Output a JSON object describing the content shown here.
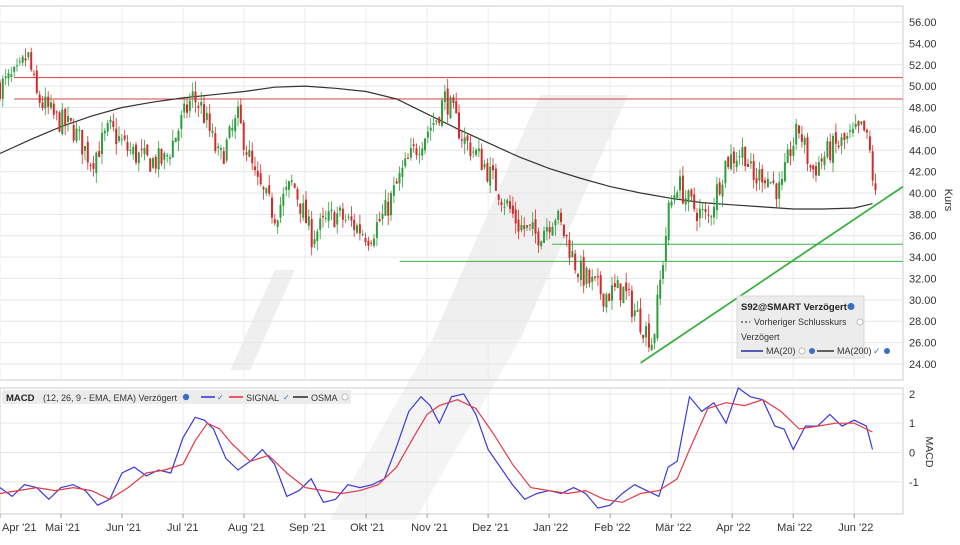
{
  "chart_data": [
    {
      "type": "candlestick",
      "title": "",
      "ylabel": "Kurs",
      "ylim": [
        22.5,
        57.5
      ],
      "y_ticks": [
        "24.00",
        "26.00",
        "28.00",
        "30.00",
        "32.00",
        "34.00",
        "36.00",
        "38.00",
        "40.00",
        "42.00",
        "44.00",
        "46.00",
        "48.00",
        "50.00",
        "52.00",
        "54.00",
        "56.00"
      ],
      "x_categories": [
        "Apr '21",
        "Mai '21",
        "Jun '21",
        "Jul '21",
        "Aug '21",
        "Sep '21",
        "Okt '21",
        "Nov '21",
        "Dez '21",
        "Jan '22",
        "Feb '22",
        "Mär '22",
        "Apr '22",
        "Mai '22",
        "Jun '22"
      ],
      "x_domain": [
        0,
        14.8
      ],
      "grid": true,
      "colors": {
        "up": "#2e9e3e",
        "down": "#d42a2a",
        "ma200": "#333333",
        "resistance": "#d94040",
        "support": "#3cb043"
      },
      "price_anchors": {
        "x": [
          0,
          0.3,
          0.45,
          0.6,
          0.9,
          1.2,
          1.5,
          1.8,
          2.1,
          2.4,
          2.7,
          3.0,
          3.15,
          3.3,
          3.6,
          3.9,
          4.2,
          4.5,
          4.8,
          5.1,
          5.3,
          5.5,
          5.8,
          6.05,
          6.3,
          6.6,
          6.9,
          7.15,
          7.3,
          7.45,
          7.6,
          7.9,
          8.2,
          8.5,
          8.8,
          9.1,
          9.3,
          9.45,
          9.6,
          9.9,
          10.2,
          10.5,
          10.7,
          10.85,
          10.95,
          11.1,
          11.3,
          11.6,
          11.9,
          12.2,
          12.35,
          12.5,
          12.8,
          12.95,
          13.1,
          13.3,
          13.6,
          13.9,
          14.15,
          14.25,
          14.35
        ],
        "y": [
          50,
          51,
          53,
          49,
          47,
          46,
          43,
          46,
          44,
          43,
          43,
          47,
          49,
          48,
          43,
          47,
          41,
          38,
          41,
          36,
          37,
          38,
          37,
          36,
          38,
          42,
          45,
          47,
          49,
          47,
          45,
          43,
          40,
          37,
          36,
          38,
          35.5,
          33,
          32,
          30.5,
          31,
          28,
          26,
          33,
          38,
          41,
          39,
          37.5,
          43,
          44,
          41,
          42,
          40,
          44,
          46,
          42,
          44,
          45,
          46,
          44,
          39.5
        ]
      },
      "ma200": {
        "x": [
          0,
          0.5,
          1,
          1.5,
          2,
          2.5,
          3,
          3.5,
          4,
          4.5,
          5,
          5.5,
          6,
          6.5,
          7,
          7.5,
          8,
          8.5,
          9,
          9.5,
          10,
          10.5,
          11,
          11.5,
          12,
          12.5,
          13,
          13.5,
          14,
          14.3
        ],
        "y": [
          43.7,
          45,
          46.2,
          47.2,
          48,
          48.5,
          48.9,
          49.2,
          49.5,
          49.9,
          50,
          49.8,
          49.5,
          48.8,
          47.4,
          46,
          44.7,
          43.4,
          42.3,
          41.4,
          40.6,
          40,
          39.5,
          39.1,
          38.9,
          38.7,
          38.5,
          38.5,
          38.6,
          39
        ]
      },
      "resistance_levels": [
        50.8,
        48.8
      ],
      "support_levels": [
        35.2,
        33.6
      ],
      "trendline": {
        "x": [
          10.5,
          14.8
        ],
        "y": [
          24.1,
          40.6
        ]
      },
      "legend": {
        "ticker": "S92@SMART Verzögert",
        "prev_close": "Vorheriger Schlusskurs",
        "delayed": "Verzögert",
        "ma20": "MA(20)",
        "ma200": "MA(200)"
      }
    },
    {
      "type": "line",
      "title": "MACD",
      "params": "(12, 26, 9 - EMA, EMA) Verzögert",
      "ylabel": "MACD",
      "ylim": [
        -2.1,
        2.2
      ],
      "y_ticks": [
        "-1",
        "0",
        "1",
        "2"
      ],
      "x_domain": [
        0,
        14.8
      ],
      "grid": true,
      "series": [
        {
          "name": "",
          "color": "#3a3adc",
          "x": [
            0,
            0.2,
            0.4,
            0.6,
            0.8,
            1.0,
            1.2,
            1.4,
            1.6,
            1.8,
            2.0,
            2.2,
            2.4,
            2.6,
            2.8,
            3.0,
            3.2,
            3.35,
            3.5,
            3.7,
            3.9,
            4.1,
            4.3,
            4.5,
            4.7,
            4.9,
            5.1,
            5.3,
            5.5,
            5.7,
            5.9,
            6.1,
            6.3,
            6.5,
            6.7,
            6.9,
            7.05,
            7.2,
            7.4,
            7.6,
            7.8,
            8.0,
            8.2,
            8.4,
            8.6,
            8.8,
            9.0,
            9.2,
            9.4,
            9.6,
            9.8,
            10.0,
            10.2,
            10.4,
            10.6,
            10.8,
            10.95,
            11.1,
            11.3,
            11.5,
            11.7,
            11.9,
            12.1,
            12.3,
            12.5,
            12.7,
            12.85,
            13.0,
            13.2,
            13.4,
            13.6,
            13.8,
            14.0,
            14.2,
            14.3
          ],
          "y": [
            -1.2,
            -1.5,
            -1.1,
            -1.2,
            -1.6,
            -1.2,
            -1.1,
            -1.3,
            -1.8,
            -1.6,
            -0.7,
            -0.5,
            -0.8,
            -0.6,
            -0.7,
            0.5,
            1.2,
            1.1,
            0.8,
            -0.2,
            -0.6,
            -0.3,
            0.1,
            -0.4,
            -1.5,
            -1.3,
            -0.9,
            -1.7,
            -1.6,
            -1.1,
            -1.2,
            -1.1,
            -0.9,
            0.2,
            1.4,
            1.9,
            1.6,
            1.0,
            1.9,
            2.0,
            1.3,
            0.1,
            -0.5,
            -1.1,
            -1.6,
            -1.4,
            -1.3,
            -1.4,
            -1.2,
            -1.4,
            -1.9,
            -1.8,
            -1.4,
            -1.1,
            -1.3,
            -1.5,
            -0.5,
            -0.3,
            1.9,
            1.4,
            1.7,
            1.0,
            2.2,
            1.9,
            1.8,
            0.9,
            0.8,
            0.1,
            0.9,
            0.9,
            1.3,
            0.9,
            1.1,
            0.9,
            0.1
          ]
        },
        {
          "name": "SIGNAL",
          "color": "#e23a4a",
          "x": [
            0,
            0.3,
            0.6,
            0.9,
            1.2,
            1.5,
            1.8,
            2.1,
            2.4,
            2.7,
            3.0,
            3.2,
            3.4,
            3.6,
            3.8,
            4.1,
            4.4,
            4.7,
            5.0,
            5.3,
            5.6,
            5.9,
            6.2,
            6.5,
            6.8,
            7.0,
            7.2,
            7.5,
            7.8,
            8.1,
            8.4,
            8.7,
            9.0,
            9.3,
            9.6,
            9.9,
            10.2,
            10.5,
            10.8,
            11.1,
            11.3,
            11.6,
            11.9,
            12.2,
            12.5,
            12.8,
            13.1,
            13.4,
            13.7,
            14.0,
            14.3
          ],
          "y": [
            -1.4,
            -1.3,
            -1.2,
            -1.3,
            -1.2,
            -1.3,
            -1.6,
            -1.2,
            -0.7,
            -0.6,
            -0.4,
            0.4,
            1.0,
            0.8,
            0.3,
            -0.3,
            -0.1,
            -0.7,
            -1.2,
            -1.3,
            -1.4,
            -1.3,
            -1.1,
            -0.5,
            0.6,
            1.3,
            1.6,
            1.8,
            1.5,
            0.6,
            -0.4,
            -1.2,
            -1.3,
            -1.4,
            -1.3,
            -1.6,
            -1.7,
            -1.4,
            -1.3,
            -0.9,
            0.1,
            1.5,
            1.7,
            1.6,
            1.8,
            1.4,
            0.8,
            0.9,
            1.0,
            1.0,
            0.7
          ]
        }
      ],
      "legend": {
        "macd": "MACD",
        "signal": "SIGNAL",
        "osma": "OSMA"
      }
    }
  ]
}
